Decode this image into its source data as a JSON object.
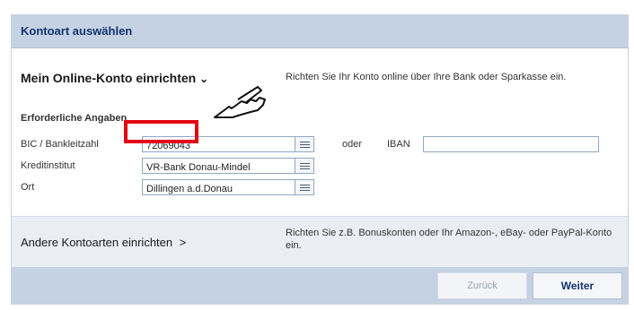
{
  "header": {
    "title": "Kontoart auswählen"
  },
  "online_section": {
    "title": "Mein Online-Konto einrichten",
    "title_chevron": "⌄",
    "description": "Richten Sie Ihr Konto online über Ihre Bank oder Sparkasse ein.",
    "required_label": "Erforderliche Angaben",
    "fields": [
      {
        "label": "BIC / Bankleitzahl",
        "value": "72069043"
      },
      {
        "label": "Kreditinstitut",
        "value": "VR-Bank Donau-Mindel"
      },
      {
        "label": "Ort",
        "value": "Dillingen a.d.Donau"
      }
    ],
    "oder_label": "oder",
    "iban_label": "IBAN",
    "iban_value": ""
  },
  "other_section": {
    "title": "Andere Kontoarten einrichten",
    "title_chevron": ">",
    "description": "Richten Sie z.B. Bonuskonten oder Ihr Amazon-, eBay- oder PayPal-Konto ein."
  },
  "footer": {
    "back_label": "Zurück",
    "next_label": "Weiter"
  },
  "colors": {
    "header_bg": "#c4d2e4",
    "accent_text": "#14336b",
    "highlight_red": "#e20613"
  },
  "icons": [
    "list-icon",
    "hand-pointer-icon"
  ]
}
